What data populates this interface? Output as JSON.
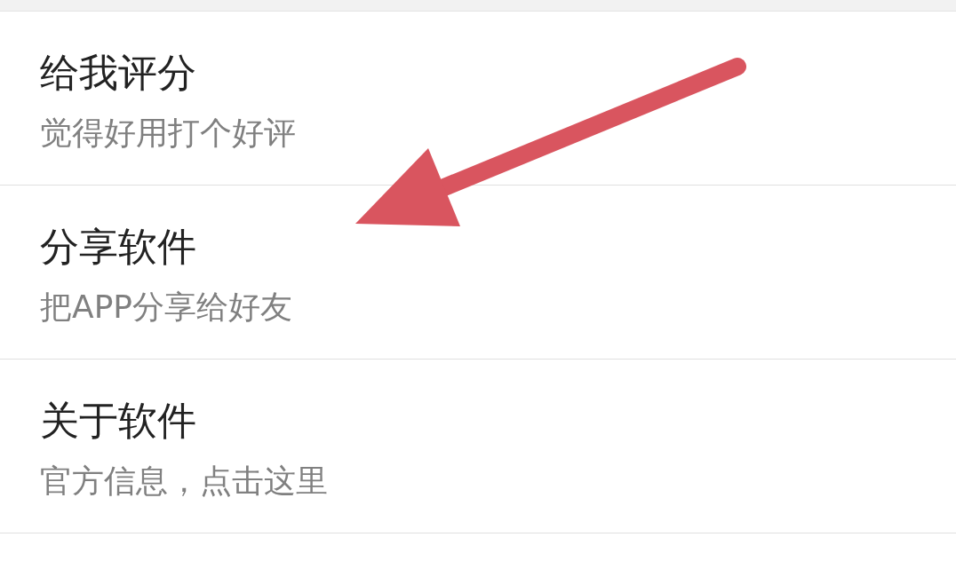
{
  "settings_items": [
    {
      "title": "给我评分",
      "subtitle": "觉得好用打个好评",
      "arrow": false
    },
    {
      "title": "分享软件",
      "subtitle": "把APP分享给好友",
      "arrow": true
    },
    {
      "title": "关于软件",
      "subtitle": "官方信息，点击这里",
      "arrow": false
    }
  ]
}
